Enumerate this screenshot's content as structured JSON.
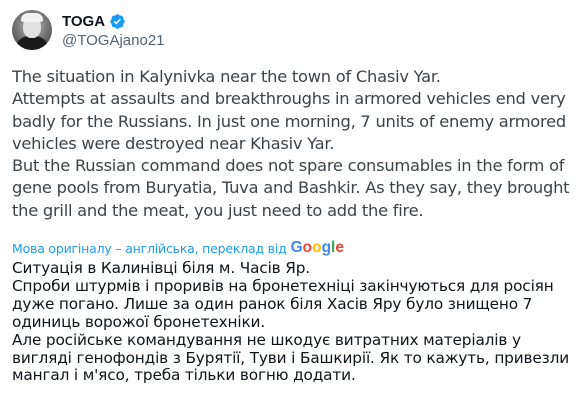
{
  "author": {
    "display_name": "TOGA",
    "handle": "@TOGAjano21",
    "verified_color": "#1d9bf0"
  },
  "original_text": [
    "The situation in Kalynivka near the town of Chasiv Yar.",
    "Attempts at assaults and breakthroughs in armored vehicles end very badly for the Russians. In just one morning, 7 units of enemy armored vehicles were destroyed near Khasiv Yar.",
    "But the Russian command does not spare consumables in the form of gene pools from Buryatia, Tuva and Bashkir. As they say, they brought the grill and the meat, you just need to add the fire."
  ],
  "translation": {
    "link_label": "Мова оригіналу – англійська, переклад від",
    "provider": "Google",
    "provider_colors": [
      "#4285f4",
      "#ea4335",
      "#fbbc05",
      "#4285f4",
      "#34a853",
      "#ea4335"
    ]
  },
  "translated_text": [
    "Ситуація в Калинівці біля м. Часів Яр.",
    "Спроби штурмів і проривів на бронетехніці закінчуються для росіян дуже погано. Лише за один ранок біля Хасів Яру було знищено 7 одиниць ворожої бронетехніки.",
    "Але російське командування не шкодує витратних матеріалів у вигляді генофондів з Бурятії, Туви і Башкирії. Як то кажуть, привезли мангал і м'ясо, треба тільки вогню додати."
  ],
  "icons": {
    "verified": "verified-badge-icon"
  }
}
